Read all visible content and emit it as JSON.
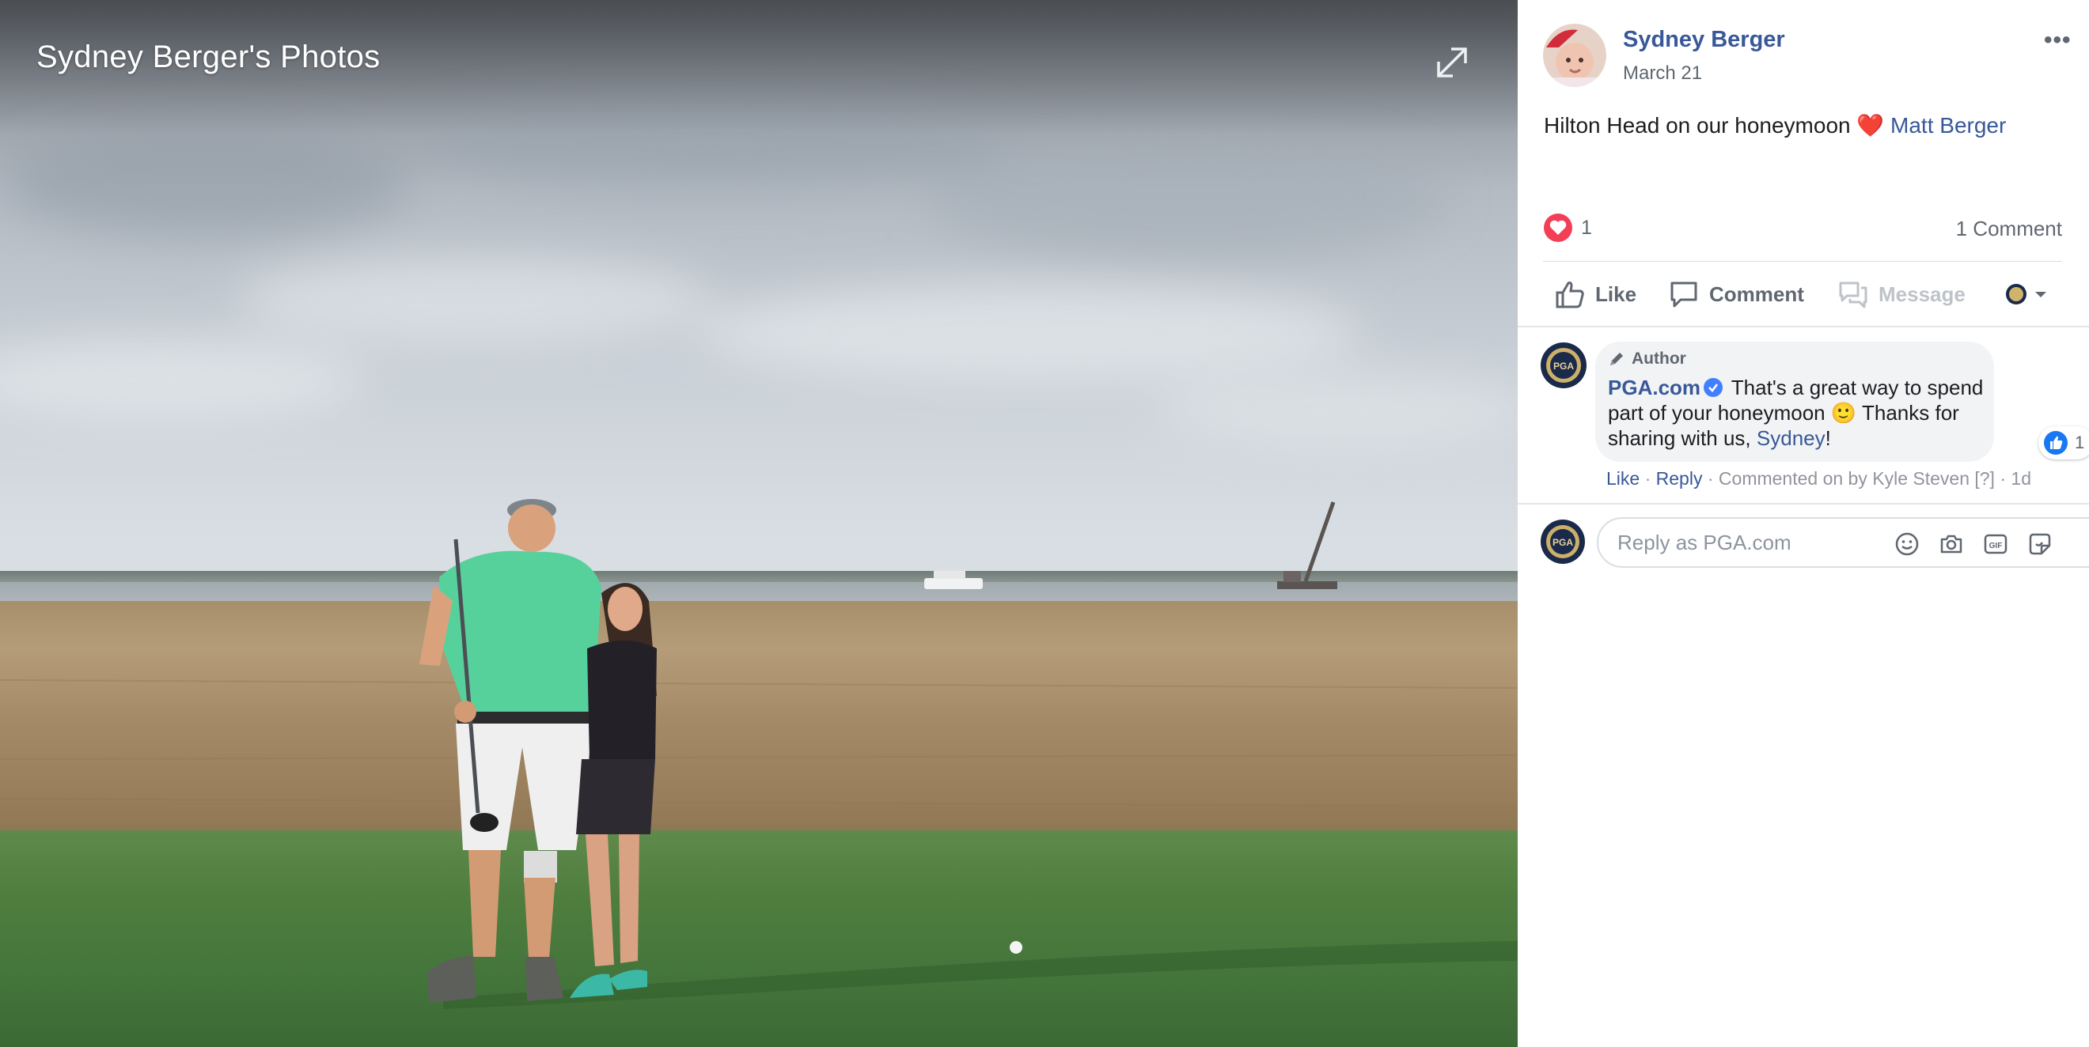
{
  "photo": {
    "album_title": "Sydney Berger's Photos"
  },
  "post": {
    "author_name": "Sydney Berger",
    "date": "March 21",
    "text": "Hilton Head on our honeymoon",
    "heart_emoji": "❤️",
    "tagged_person": "Matt Berger",
    "reaction_count": "1",
    "comment_count": "1 Comment",
    "more_icon": "more-dots-icon"
  },
  "actions": {
    "like": "Like",
    "comment": "Comment",
    "message": "Message"
  },
  "comment": {
    "badge": "Author",
    "commenter": "PGA.com",
    "text_part1": "That's a great way to spend part of your honeymoon",
    "emoji": "🙂",
    "text_part2": "Thanks for sharing with us,",
    "mention": "Sydney",
    "text_end": "!",
    "like_count": "1",
    "meta": {
      "like": "Like",
      "reply": "Reply",
      "commented_by": "Commented on by Kyle Steven [?]",
      "time": "1d",
      "sep": "·"
    }
  },
  "reply": {
    "placeholder": "Reply as PGA.com"
  },
  "avatars": {
    "pga_label": "PGA"
  },
  "colors": {
    "link": "#385898",
    "heart": "#f33e58",
    "like_blue": "#1877f2"
  }
}
